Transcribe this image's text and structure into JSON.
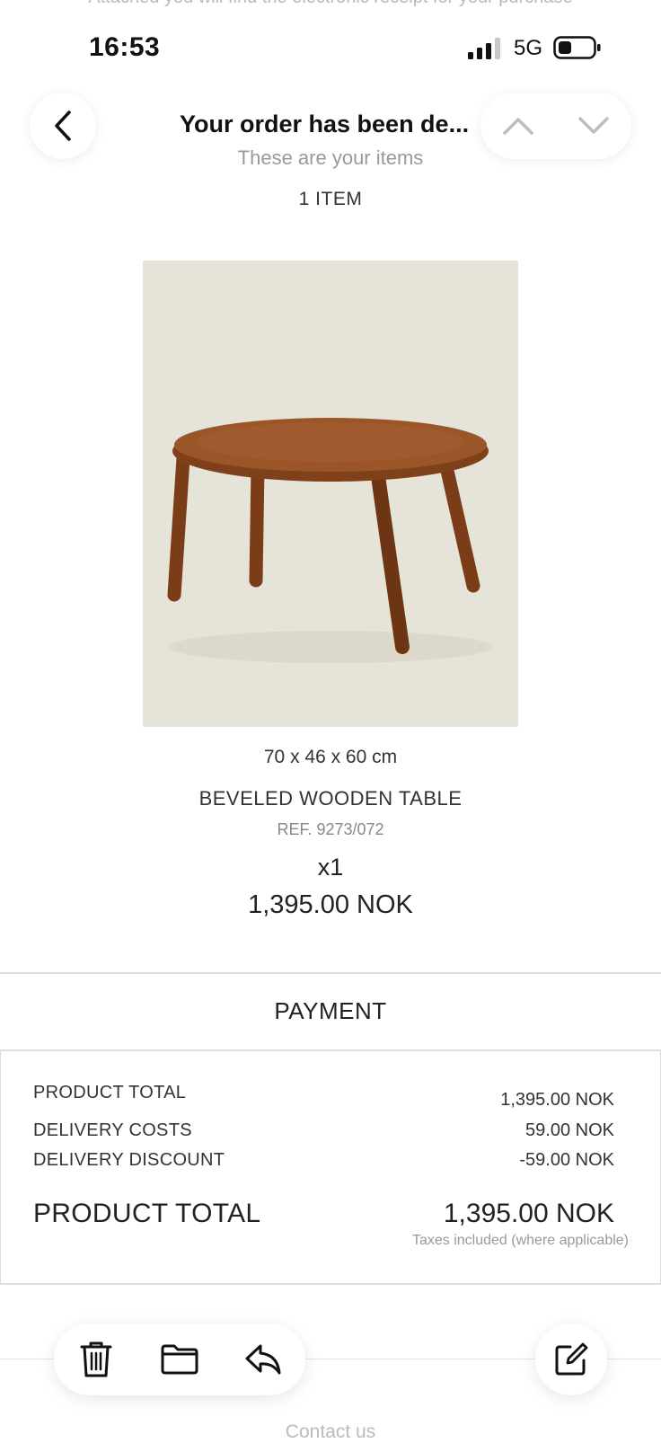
{
  "email": {
    "faded_top_text": "Attached you will find the electronic receipt for your purchase",
    "subject": "Your order has been de...",
    "subtitle": "These are your items",
    "items_count": "1 ITEM"
  },
  "status_bar": {
    "time": "16:53",
    "network": "5G"
  },
  "product": {
    "dimensions": "70 x 46 x 60 cm",
    "name": "BEVELED WOODEN TABLE",
    "ref": "REF. 9273/072",
    "quantity": "x1",
    "price": "1,395.00 NOK"
  },
  "payment": {
    "title": "PAYMENT",
    "rows": [
      {
        "label": "PRODUCT TOTAL",
        "value": "1,395.00 NOK"
      },
      {
        "label": "DELIVERY COSTS",
        "value": "59.00 NOK"
      },
      {
        "label": "DELIVERY DISCOUNT",
        "value": "-59.00 NOK"
      }
    ],
    "total_label": "PRODUCT TOTAL",
    "total_value": "1,395.00 NOK",
    "taxes_note": "Taxes included (where applicable)"
  },
  "footer": {
    "contact": "Contact us"
  },
  "icons": {
    "back": "chevron-left-icon",
    "prev": "chevron-up-icon",
    "next": "chevron-down-icon",
    "trash": "trash-icon",
    "folder": "folder-icon",
    "reply": "reply-icon",
    "compose": "compose-icon"
  }
}
